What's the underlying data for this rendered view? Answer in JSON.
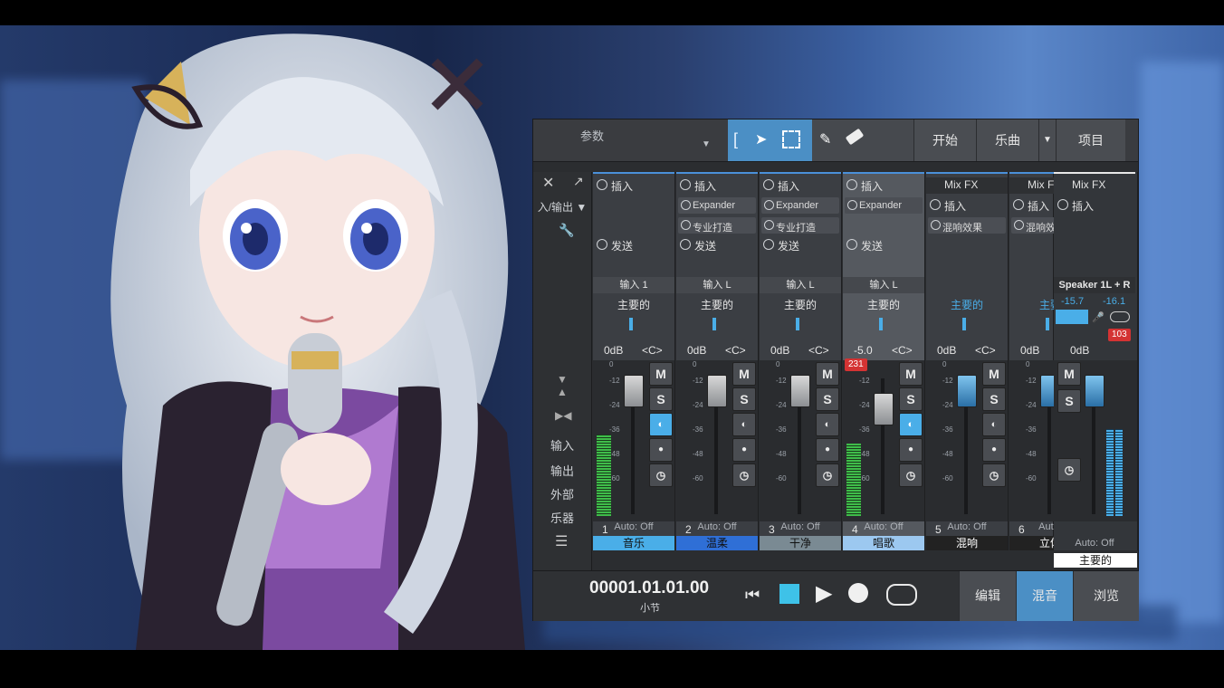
{
  "toolbar": {
    "param_label": "参数",
    "start_label": "开始",
    "song_label": "乐曲",
    "project_label": "项目"
  },
  "left_panel": {
    "io_label": "入/输出",
    "items": [
      "输入",
      "输出",
      "外部",
      "乐器"
    ]
  },
  "channels": [
    {
      "num": "1",
      "insert": "插入",
      "plugins": [],
      "send": "发送",
      "input": "输入 1",
      "main": "主要的",
      "vol": "0dB",
      "pan": "<C>",
      "auto": "Auto: Off",
      "name": "音乐",
      "name_color": "#4aaee8"
    },
    {
      "num": "2",
      "insert": "插入",
      "plugins": [
        "Expander",
        "专业打造"
      ],
      "send": "发送",
      "input": "输入 L",
      "main": "主要的",
      "vol": "0dB",
      "pan": "<C>",
      "auto": "Auto: Off",
      "name": "温柔",
      "name_color": "#2f6fd6"
    },
    {
      "num": "3",
      "insert": "插入",
      "plugins": [
        "Expander",
        "专业打造"
      ],
      "send": "发送",
      "input": "输入 L",
      "main": "主要的",
      "vol": "0dB",
      "pan": "<C>",
      "auto": "Auto: Off",
      "name": "干净",
      "name_color": "#7a8a93"
    },
    {
      "num": "4",
      "insert": "插入",
      "plugins": [
        "Expander"
      ],
      "send": "发送",
      "input": "输入 L",
      "main": "主要的",
      "vol": "-5.0",
      "pan": "<C>",
      "auto": "Auto: Off",
      "name": "唱歌",
      "name_color": "#9cc8f0",
      "peak": "231"
    },
    {
      "num": "5",
      "insert": "插入",
      "plugins": [
        "混响效果"
      ],
      "mixfx": "Mix FX",
      "send": "",
      "input": "",
      "main": "主要的",
      "vol": "0dB",
      "pan": "<C>",
      "auto": "Auto: Off",
      "name": "混响",
      "name_color": "#222"
    },
    {
      "num": "6",
      "insert": "插入",
      "plugins": [
        "混响效"
      ],
      "mixfx": "Mix F",
      "send": "",
      "input": "",
      "main": "主要",
      "vol": "0dB",
      "pan": "",
      "auto": "Auto:",
      "name": "立体",
      "name_color": "#222"
    }
  ],
  "master": {
    "mixfx": "Mix FX",
    "insert": "插入",
    "output": "Speaker 1L + R",
    "level_l": "-15.7",
    "level_r": "-16.1",
    "vol": "0dB",
    "peak": "103",
    "auto": "Auto: Off",
    "name": "主要的"
  },
  "transport": {
    "time": "00001.01.01.00",
    "unit": "小节",
    "edit_label": "编辑",
    "mix_label": "混音",
    "browse_label": "浏览"
  },
  "colors": {
    "accent": "#4aaee8",
    "meter": "#3fbd4a",
    "peak": "#d43333"
  }
}
